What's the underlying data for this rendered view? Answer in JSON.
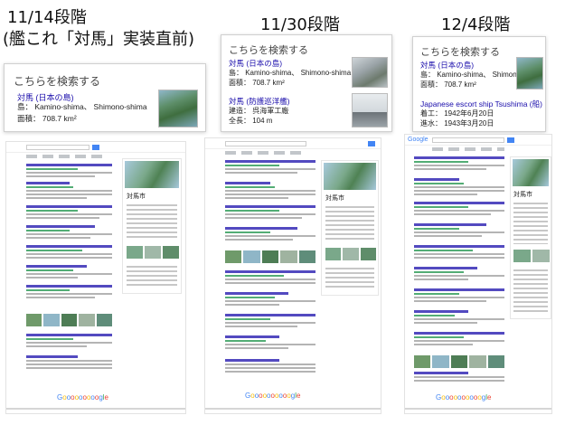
{
  "stages": [
    {
      "title": "11/14段階",
      "subtitle": "(艦これ「対馬」実装直前)",
      "card": {
        "header": "こちらを検索する",
        "entries": [
          {
            "link": "対馬 (日本の島)",
            "rows": [
              "島： Kamino-shima、 Shimono-shima",
              "面積： 708.7 km²"
            ]
          }
        ]
      },
      "mini": {
        "panel_title": "対馬市",
        "footer": "Gooooooooogle"
      }
    },
    {
      "title": "11/30段階",
      "card": {
        "header": "こちらを検索する",
        "entries": [
          {
            "link": "対馬 (日本の島)",
            "rows": [
              "島： Kamino-shima、 Shimono-shima",
              "面積： 708.7 km²"
            ]
          },
          {
            "link": "対馬 (防護巡洋艦)",
            "rows": [
              "建造： 呉海軍工廠",
              "全長： 104 m"
            ]
          }
        ]
      },
      "mini": {
        "panel_title": "対馬市",
        "footer": "Goooooooooogle"
      }
    },
    {
      "title": "12/4段階",
      "card": {
        "header": "こちらを検索する",
        "entries": [
          {
            "link": "対馬 (日本の島)",
            "rows": [
              "島： Kamino-shima、 Shimono-shima",
              "面積： 708.7 km²"
            ]
          },
          {
            "link": "Japanese escort ship Tsushima (船)",
            "rows": [
              "着工： 1942年6月20日",
              "進水： 1943年3月20日"
            ]
          }
        ]
      },
      "mini": {
        "panel_title": "対馬市",
        "logo": "Google",
        "footer": "Goooooooooogle"
      }
    }
  ],
  "colors": {
    "link": "#1a0dab",
    "url": "#0a8a3a",
    "google_blue": "#4285f4"
  }
}
